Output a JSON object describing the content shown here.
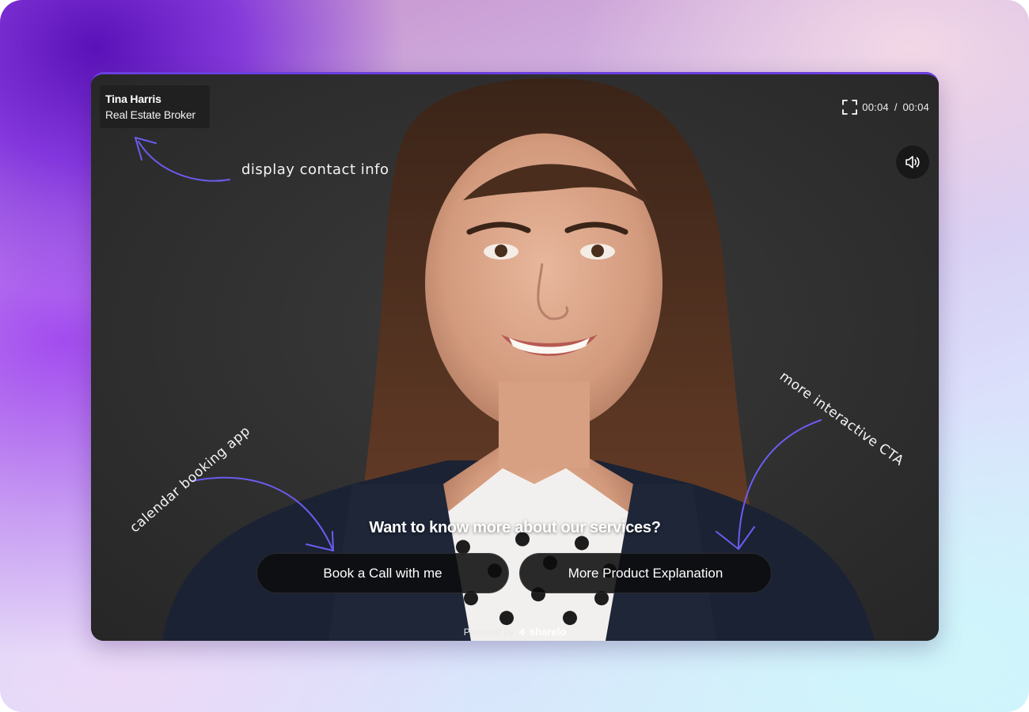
{
  "contact": {
    "name": "Tina Harris",
    "role": "Real Estate Broker"
  },
  "player": {
    "current_time": "00:04",
    "separator": "/",
    "duration": "00:04",
    "fullscreen_icon": "fullscreen-icon",
    "sound_icon": "speaker-icon"
  },
  "annotations": {
    "contact": "display contact info",
    "calendar": "calendar booking app",
    "cta": "more interactive CTA"
  },
  "cta": {
    "title": "Want to know more about our services?",
    "book_label": "Book a Call with me",
    "more_label": "More Product Explanation"
  },
  "footer": {
    "powered_by": "Powered by",
    "brand": "sharelo"
  },
  "colors": {
    "accent": "#6a3fe0",
    "arrow": "#6b5cf0"
  }
}
